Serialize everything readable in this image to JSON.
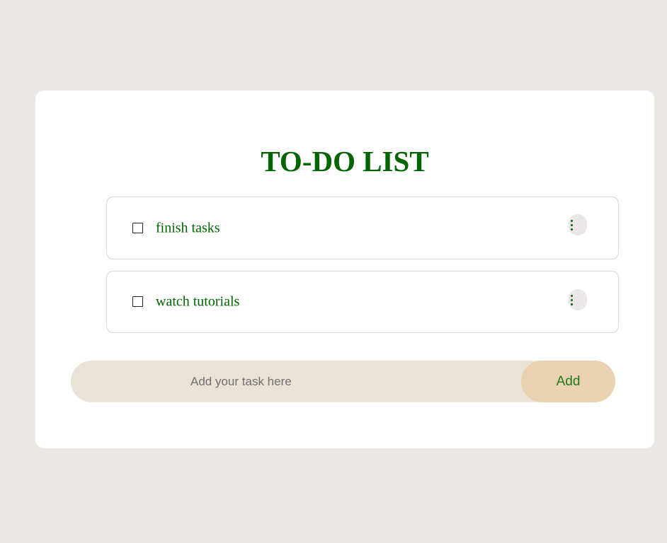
{
  "page": {
    "title": "TO-DO LIST"
  },
  "tasks": [
    {
      "label": "finish tasks",
      "checked": false
    },
    {
      "label": "watch tutorials",
      "checked": false
    }
  ],
  "input": {
    "placeholder": "Add your task here",
    "value": ""
  },
  "add_button": {
    "label": "Add"
  },
  "icons": {
    "checkbox": "checkbox-icon",
    "menu": "kebab-menu-icon"
  },
  "colors": {
    "background": "#ebe7e2",
    "card": "#ffffff",
    "accent_text": "#006400",
    "input_bar": "#ebe2d6",
    "add_button": "#ead2b0",
    "menu_button": "#ece6e6"
  }
}
